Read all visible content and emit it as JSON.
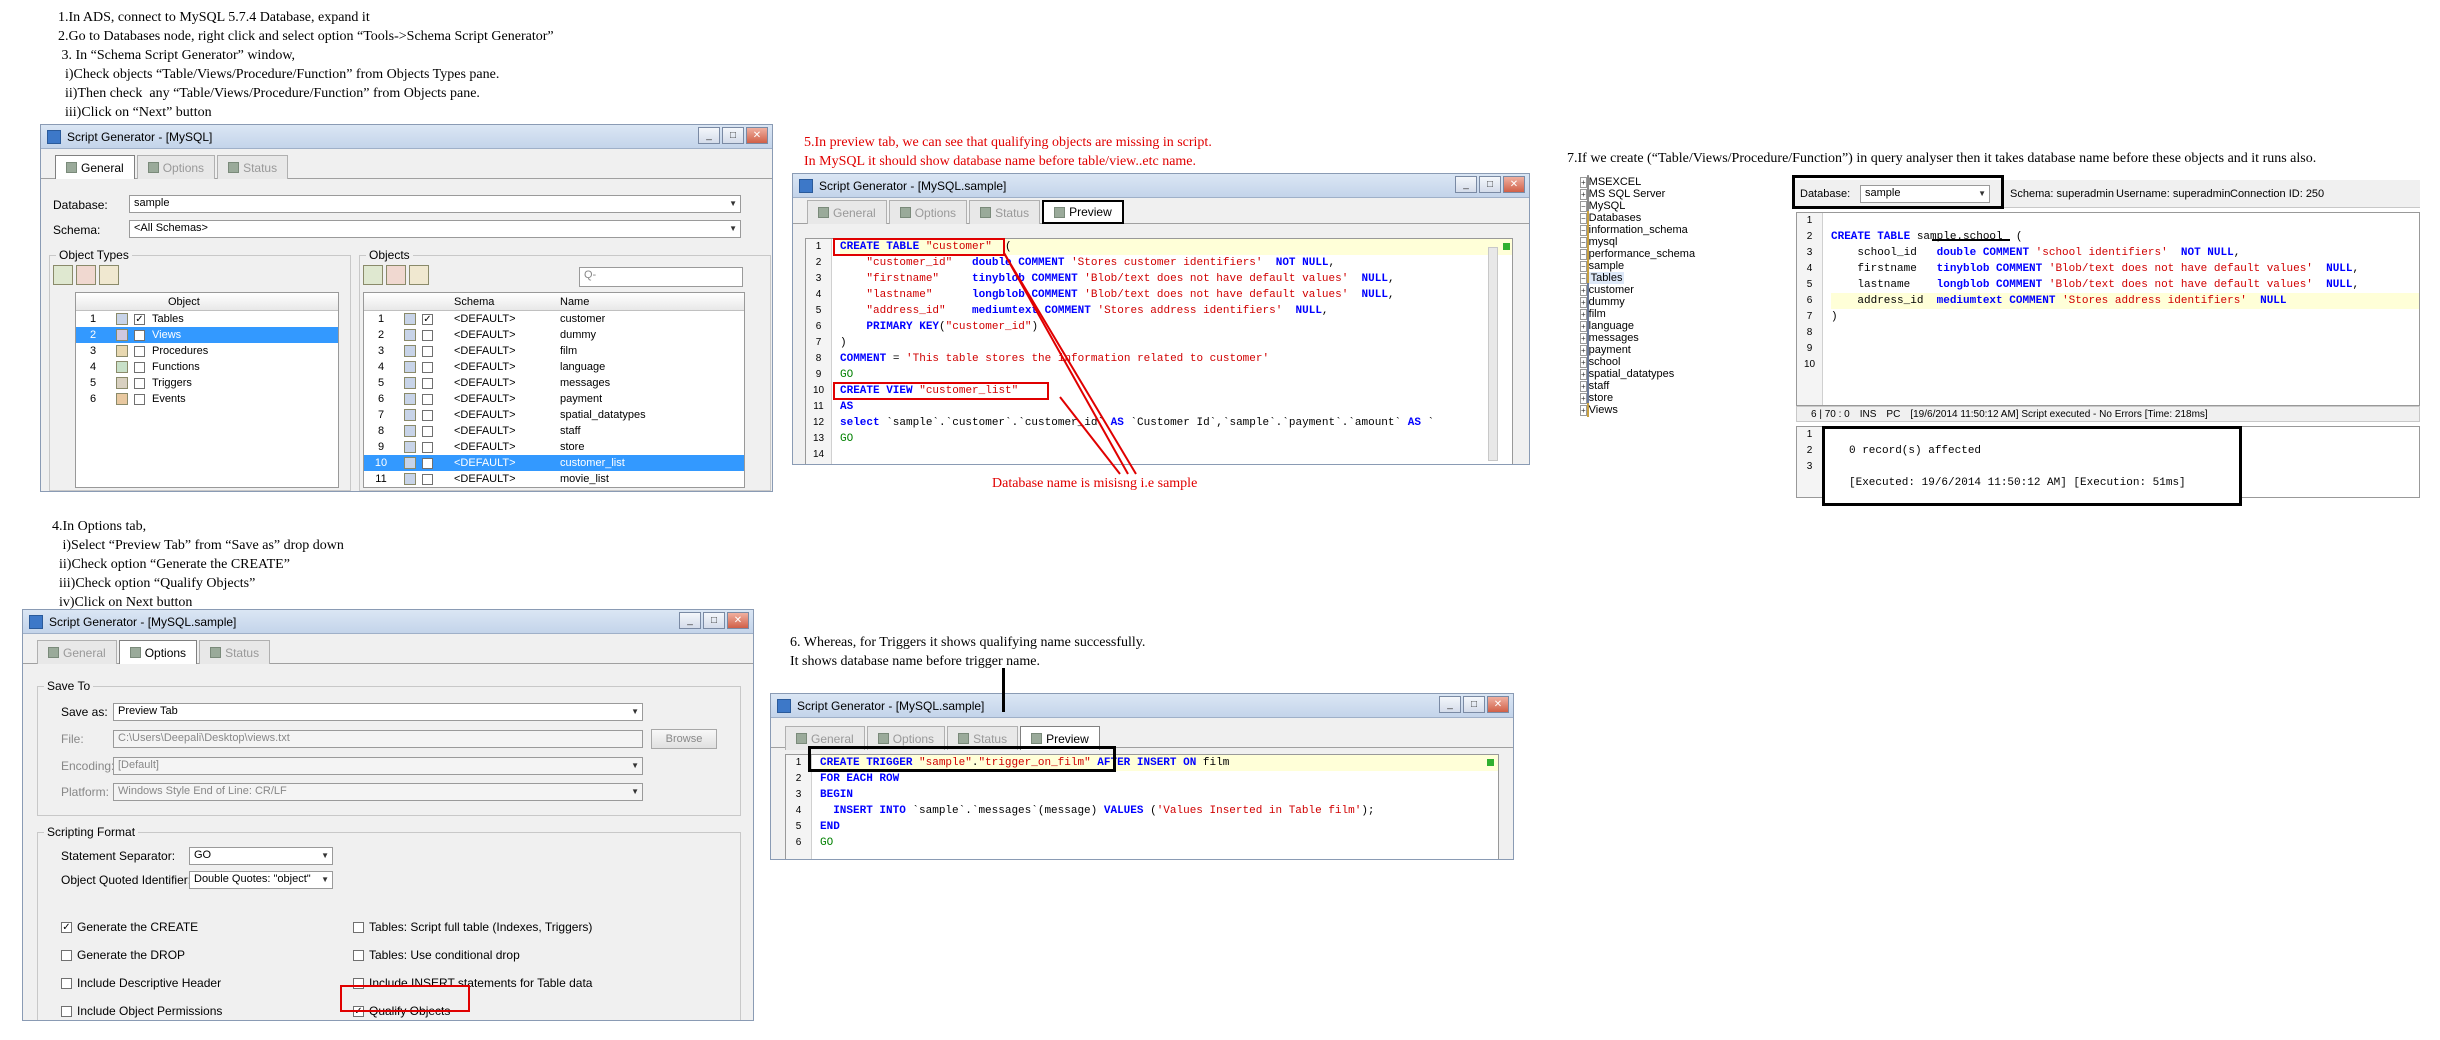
{
  "notes": {
    "step1": "1.In ADS, connect to MySQL 5.7.4 Database, expand it\n2.Go to Databases node, right click and select option “Tools->Schema Script Generator”\n 3. In “Schema Script Generator” window,\n  i)Check objects “Table/Views/Procedure/Function” from Objects Types pane.\n  ii)Then check  any “Table/Views/Procedure/Function” from Objects pane.\n  iii)Click on “Next” button",
    "step4": "4.In Options tab,\n   i)Select “Preview Tab” from “Save as” drop down\n  ii)Check option “Generate the CREATE”\n  iii)Check option “Qualify Objects”\n  iv)Click on Next button",
    "step5": "5.In preview tab, we can see that qualifying objects are missing in script.\nIn MySQL it should show database name before table/view..etc name.",
    "step5_callout": "Database name is misisng i.e sample",
    "step6": "6. Whereas, for Triggers it shows qualifying name successfully.\nIt shows database name before trigger name.",
    "step7": "7.If we create (“Table/Views/Procedure/Function”) in query analyser then it takes database name before these objects and it runs also."
  },
  "win1": {
    "title": "Script Generator - [MySQL]",
    "tabs": [
      "General",
      "Options",
      "Status"
    ],
    "database_label": "Database:",
    "database_value": "sample",
    "schema_label": "Schema:",
    "schema_value": "<All Schemas>",
    "object_types_title": "Object Types",
    "objects_title": "Objects",
    "search_placeholder": "Q-",
    "types_header": "Object",
    "types": [
      {
        "n": "1",
        "label": "Tables",
        "checked": true
      },
      {
        "n": "2",
        "label": "Views",
        "checked": true
      },
      {
        "n": "3",
        "label": "Procedures",
        "checked": false
      },
      {
        "n": "4",
        "label": "Functions",
        "checked": false
      },
      {
        "n": "5",
        "label": "Triggers",
        "checked": false
      },
      {
        "n": "6",
        "label": "Events",
        "checked": false
      }
    ],
    "objects_headers": [
      "Schema",
      "Name"
    ],
    "objects": [
      {
        "n": "1",
        "schema": "<DEFAULT>",
        "name": "customer",
        "checked": true
      },
      {
        "n": "2",
        "schema": "<DEFAULT>",
        "name": "dummy",
        "checked": false
      },
      {
        "n": "3",
        "schema": "<DEFAULT>",
        "name": "film",
        "checked": false
      },
      {
        "n": "4",
        "schema": "<DEFAULT>",
        "name": "language",
        "checked": false
      },
      {
        "n": "5",
        "schema": "<DEFAULT>",
        "name": "messages",
        "checked": false
      },
      {
        "n": "6",
        "schema": "<DEFAULT>",
        "name": "payment",
        "checked": false
      },
      {
        "n": "7",
        "schema": "<DEFAULT>",
        "name": "spatial_datatypes",
        "checked": false
      },
      {
        "n": "8",
        "schema": "<DEFAULT>",
        "name": "staff",
        "checked": false
      },
      {
        "n": "9",
        "schema": "<DEFAULT>",
        "name": "store",
        "checked": false
      },
      {
        "n": "10",
        "schema": "<DEFAULT>",
        "name": "customer_list",
        "checked": true
      },
      {
        "n": "11",
        "schema": "<DEFAULT>",
        "name": "movie_list",
        "checked": false
      }
    ]
  },
  "win2": {
    "title": "Script Generator - [MySQL.sample]",
    "tabs": [
      "General",
      "Options",
      "Status",
      "Preview"
    ],
    "line_numbers": [
      "1",
      "2",
      "3",
      "4",
      "5",
      "6",
      "7",
      "8",
      "9",
      "10",
      "11",
      "12",
      "13",
      "14"
    ]
  },
  "win3": {
    "title": "Script Generator - [MySQL.sample]",
    "tabs": [
      "General",
      "Options",
      "Status"
    ],
    "save_to_title": "Save To",
    "save_as_label": "Save as:",
    "save_as_value": "Preview Tab",
    "file_label": "File:",
    "file_value": "C:\\Users\\Deepali\\Desktop\\views.txt",
    "browse_label": "Browse",
    "encoding_label": "Encoding:",
    "encoding_value": "[Default]",
    "platform_label": "Platform:",
    "platform_value": "Windows Style End of Line: CR/LF",
    "scripting_title": "Scripting Format",
    "separator_label": "Statement Separator:",
    "separator_value": "GO",
    "quoted_label": "Object Quoted Identifier:",
    "quoted_value": "Double Quotes: \"object\"",
    "options_left": [
      {
        "label": "Generate the CREATE",
        "checked": true
      },
      {
        "label": "Generate the DROP",
        "checked": false
      },
      {
        "label": "Include Descriptive Header",
        "checked": false
      },
      {
        "label": "Include Object Permissions",
        "checked": false
      }
    ],
    "options_right": [
      {
        "label": "Tables: Script full table (Indexes, Triggers)",
        "checked": false
      },
      {
        "label": "Tables: Use conditional drop",
        "checked": false
      },
      {
        "label": "Include INSERT statements for Table data",
        "checked": false
      },
      {
        "label": "Qualify Objects",
        "checked": true
      }
    ]
  },
  "win4": {
    "title": "Script Generator - [MySQL.sample]",
    "tabs": [
      "General",
      "Options",
      "Status",
      "Preview"
    ],
    "line_numbers": [
      "1",
      "2",
      "3",
      "4",
      "5",
      "6"
    ]
  },
  "qa": {
    "tree": [
      {
        "label": "MSEXCEL",
        "level": 0,
        "kind": "db"
      },
      {
        "label": "MS SQL Server",
        "level": 0,
        "kind": "db"
      },
      {
        "label": "MySQL",
        "level": 0,
        "kind": "db"
      },
      {
        "label": "Databases",
        "level": 1,
        "kind": "folder"
      },
      {
        "label": "information_schema",
        "level": 2,
        "kind": "folder"
      },
      {
        "label": "mysql",
        "level": 2,
        "kind": "folder"
      },
      {
        "label": "performance_schema",
        "level": 2,
        "kind": "folder"
      },
      {
        "label": "sample",
        "level": 2,
        "kind": "folder"
      },
      {
        "label": "Tables",
        "level": 3,
        "kind": "folder"
      },
      {
        "label": "customer",
        "level": 4,
        "kind": "table"
      },
      {
        "label": "dummy",
        "level": 4,
        "kind": "table"
      },
      {
        "label": "film",
        "level": 4,
        "kind": "table"
      },
      {
        "label": "language",
        "level": 4,
        "kind": "table"
      },
      {
        "label": "messages",
        "level": 4,
        "kind": "table"
      },
      {
        "label": "payment",
        "level": 4,
        "kind": "table"
      },
      {
        "label": "school",
        "level": 4,
        "kind": "table"
      },
      {
        "label": "spatial_datatypes",
        "level": 4,
        "kind": "table"
      },
      {
        "label": "staff",
        "level": 4,
        "kind": "table"
      },
      {
        "label": "store",
        "level": 4,
        "kind": "table"
      },
      {
        "label": "Views",
        "level": 3,
        "kind": "folder"
      }
    ],
    "db_label": "Database:",
    "db_value": "sample",
    "schema_text": "Schema: superadmin",
    "user_text": "Username: superadmin",
    "conn_text": "Connection ID: 250",
    "line_numbers": [
      "1",
      "2",
      "3",
      "4",
      "5",
      "6",
      "7",
      "8",
      "9",
      "10"
    ],
    "status_pos": "6 | 70 : 0",
    "status_ins": "INS",
    "status_pc": "PC",
    "status_msg": "[19/6/2014 11:50:12 AM] Script executed - No Errors [Time: 218ms]",
    "result_lines": [
      "1",
      "2",
      "3"
    ],
    "result_affected": "0 record(s) affected",
    "result_executed": "[Executed: 19/6/2014 11:50:12 AM] [Execution: 51ms]"
  }
}
